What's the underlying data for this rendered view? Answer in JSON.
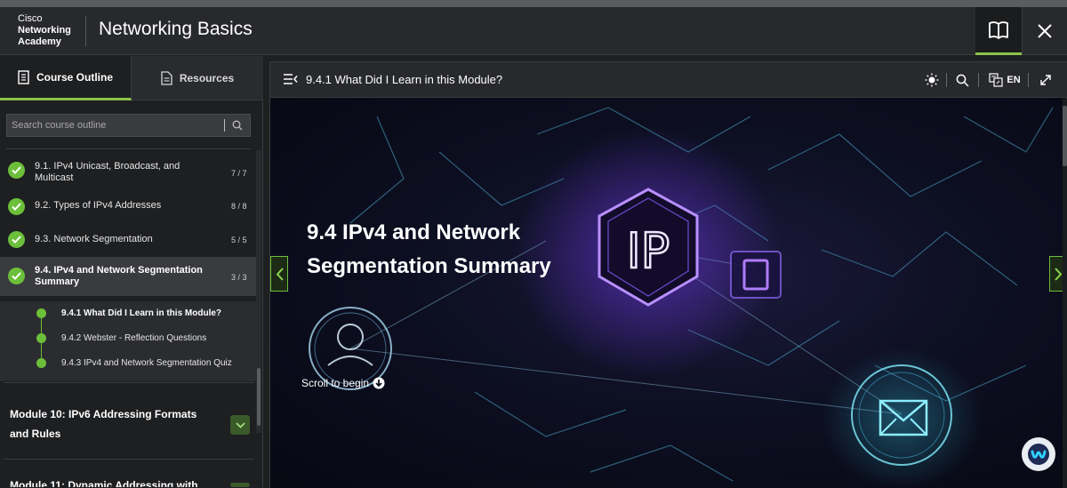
{
  "header": {
    "brand_line1": "Cisco",
    "brand_line2": "Networking",
    "brand_line3": "Academy",
    "title": "Networking Basics"
  },
  "left_panel": {
    "tabs": [
      {
        "label": "Course Outline",
        "icon": "document-icon",
        "active": true
      },
      {
        "label": "Resources",
        "icon": "file-icon",
        "active": false
      }
    ],
    "search_placeholder": "Search course outline",
    "items": [
      {
        "label": "9.1. IPv4 Unicast, Broadcast, and Multicast",
        "count": "7 / 7"
      },
      {
        "label": "9.2. Types of IPv4 Addresses",
        "count": "8 / 8"
      },
      {
        "label": "9.3. Network Segmentation",
        "count": "5 / 5"
      },
      {
        "label": "9.4. IPv4 and Network Segmentation Summary",
        "count": "3 / 3"
      }
    ],
    "subitems": [
      {
        "label": "9.4.1 What Did I Learn in this Module?"
      },
      {
        "label": "9.4.2 Webster - Reflection Questions"
      },
      {
        "label": "9.4.3 IPv4 and Network Segmentation Quiz"
      }
    ],
    "modules": [
      {
        "label": "Module 10: IPv6 Addressing Formats and Rules"
      },
      {
        "label": "Module 11: Dynamic Addressing with"
      }
    ]
  },
  "content": {
    "page_title": "9.4.1 What Did I Learn in this Module?",
    "language": "EN",
    "hero_title": "9.4 IPv4 and Network Segmentation Summary",
    "hero_graphic_text": "IP",
    "scroll_hint": "Scroll to begin"
  },
  "colors": {
    "accent": "#8bc34a",
    "check": "#6cbf3a",
    "header_bg": "#28292c",
    "panel_bg": "#1e1f21"
  }
}
